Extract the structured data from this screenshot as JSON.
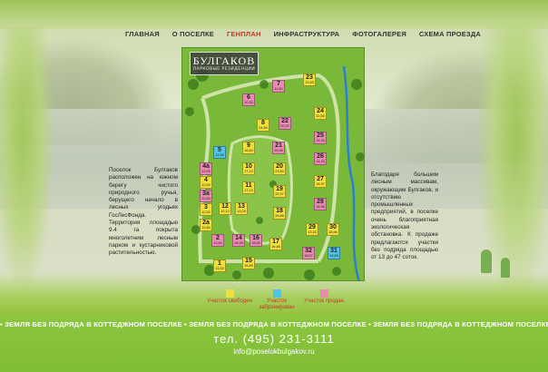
{
  "nav": {
    "items": [
      {
        "label": "ГЛАВНАЯ"
      },
      {
        "label": "О ПОСЕЛКЕ"
      },
      {
        "label": "ГЕНПЛАН"
      },
      {
        "label": "ИНФРАСТРУКТУРА"
      },
      {
        "label": "ФОТОГАЛЕРЕЯ"
      },
      {
        "label": "СХЕМА ПРОЕЗДА"
      }
    ],
    "active_index": 2
  },
  "logo": {
    "title": "БУЛГАКОВ",
    "subtitle": "ПАРКОВЫЕ РЕЗИДЕНЦИИ"
  },
  "plots": [
    {
      "n": "23",
      "a": "12,63",
      "status": "free"
    },
    {
      "n": "7",
      "a": "11,80",
      "status": "sold"
    },
    {
      "n": "6",
      "a": "10,53",
      "status": "sold"
    },
    {
      "n": "24",
      "a": "12,56",
      "status": "free"
    },
    {
      "n": "8",
      "a": "24,56",
      "status": "free"
    },
    {
      "n": "22",
      "a": "20,20",
      "status": "sold"
    },
    {
      "n": "25",
      "a": "14,33",
      "status": "sold"
    },
    {
      "n": "9",
      "a": "16,40",
      "status": "free"
    },
    {
      "n": "21",
      "a": "26,96",
      "status": "sold"
    },
    {
      "n": "5",
      "a": "11,55",
      "status": "reserved"
    },
    {
      "n": "26",
      "a": "14,33",
      "status": "sold"
    },
    {
      "n": "4a",
      "a": "12,00",
      "status": "sold"
    },
    {
      "n": "10",
      "a": "17,13",
      "status": "free"
    },
    {
      "n": "20",
      "a": "23,83",
      "status": "free"
    },
    {
      "n": "4",
      "a": "12,00",
      "status": "free"
    },
    {
      "n": "11",
      "a": "17,13",
      "status": "free"
    },
    {
      "n": "19",
      "a": "22,97",
      "status": "free"
    },
    {
      "n": "27",
      "a": "14,97",
      "status": "free"
    },
    {
      "n": "3a",
      "a": "12,60",
      "status": "sold"
    },
    {
      "n": "3",
      "a": "12,00",
      "status": "free"
    },
    {
      "n": "12",
      "a": "12,10",
      "status": "free"
    },
    {
      "n": "13",
      "a": "12,09",
      "status": "free"
    },
    {
      "n": "18",
      "a": "26,88",
      "status": "free"
    },
    {
      "n": "28",
      "a": "15,36",
      "status": "sold"
    },
    {
      "n": "2a",
      "a": "12,60",
      "status": "free"
    },
    {
      "n": "29",
      "a": "13,33",
      "status": "free"
    },
    {
      "n": "30",
      "a": "18,96",
      "status": "free"
    },
    {
      "n": "2",
      "a": "12,60",
      "status": "sold"
    },
    {
      "n": "14",
      "a": "18,39",
      "status": "sold"
    },
    {
      "n": "16",
      "a": "18,90",
      "status": "sold"
    },
    {
      "n": "17",
      "a": "16,46",
      "status": "free"
    },
    {
      "n": "32",
      "a": "18,57",
      "status": "sold"
    },
    {
      "n": "31",
      "a": "16,83",
      "status": "reserved"
    },
    {
      "n": "1",
      "a": "12,53",
      "status": "free"
    },
    {
      "n": "15",
      "a": "15,89",
      "status": "free"
    }
  ],
  "legend": [
    {
      "label": "Участок свободен",
      "color": "#f1e03a"
    },
    {
      "label": "Участок забронирован",
      "color": "#4fc3e8"
    },
    {
      "label": "Участок продан",
      "color": "#e98ab0"
    }
  ],
  "left_text": "Поселок Булгаков расположен на южном берегу чистого природного ручья, берущего начало в лесных угодьях ГосЛесФонда. Территория площадью 9.4 га покрыта многолетним лесным парком и кустарниковой растительностью.",
  "right_text": "Благодаря большим лесным массивам, окружающим Булгаков, и отсутствию промышленных предприятий, в поселке очень благоприятная экологическая обстановка. К продаже предлагаются участки без подряда площадью от 13 до 47 соток.",
  "strip": "• ЗЕМЛЯ БЕЗ ПОДРЯДА В КОТТЕДЖНОМ ПОСЕЛКЕ • ЗЕМЛЯ БЕЗ ПОДРЯДА В КОТТЕДЖНОМ ПОСЕЛКЕ • ЗЕМЛЯ БЕЗ ПОДРЯДА В КОТТЕДЖНОМ ПОСЕЛКЕ •",
  "phone": "тел. (495) 231-3111",
  "email": "info@poselokbulgakov.ru",
  "colors": {
    "active_nav": "#c0392b",
    "map_green": "#7ab83a",
    "band_green": "#8cc63f"
  }
}
